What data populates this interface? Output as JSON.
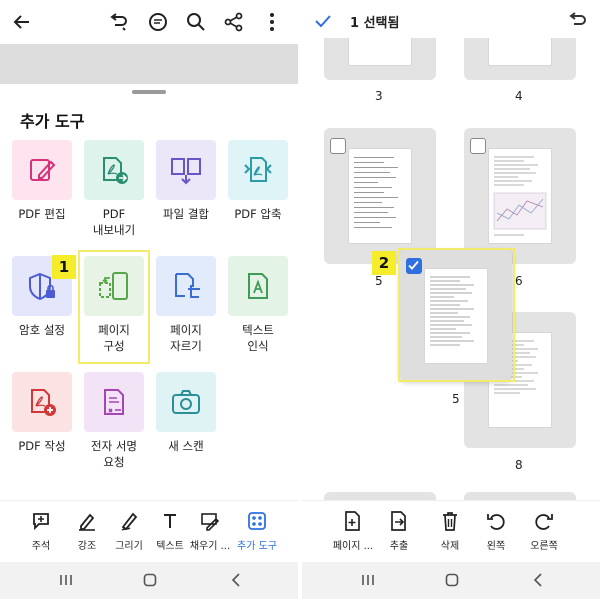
{
  "left": {
    "top_icons": [
      "back-arrow-icon",
      "undo-icon",
      "comment-icon",
      "search-icon",
      "share-icon",
      "more-vertical-icon"
    ],
    "sheet_title": "추가 도구",
    "tools": [
      {
        "label": "PDF 편집",
        "icon": "pdf-edit-icon",
        "bg": "#fde4ef",
        "color": "#d6337a"
      },
      {
        "label": "PDF\n내보내기",
        "icon": "pdf-export-icon",
        "bg": "#ddf3ec",
        "color": "#2a8f72"
      },
      {
        "label": "파일 결합",
        "icon": "file-combine-icon",
        "bg": "#ebe6f8",
        "color": "#6a55c8"
      },
      {
        "label": "PDF 압축",
        "icon": "pdf-compress-icon",
        "bg": "#dff4f6",
        "color": "#2d9aa8"
      },
      {
        "label": "암호 설정",
        "icon": "password-shield-icon",
        "bg": "#e4e6fb",
        "color": "#4c5bd4"
      },
      {
        "label": "페이지\n구성",
        "icon": "organize-pages-icon",
        "bg": "#e7f3e4",
        "color": "#57a64a"
      },
      {
        "label": "페이지\n자르기",
        "icon": "crop-page-icon",
        "bg": "#e2ebfb",
        "color": "#3a6fd1"
      },
      {
        "label": "텍스트\n인식",
        "icon": "text-recognition-icon",
        "bg": "#e3f3e5",
        "color": "#3f9b55"
      },
      {
        "label": "PDF 작성",
        "icon": "pdf-create-icon",
        "bg": "#fce3e3",
        "color": "#d23838"
      },
      {
        "label": "전자 서명\n요청",
        "icon": "e-sign-icon",
        "bg": "#f3e3f6",
        "color": "#a646b6"
      },
      {
        "label": "새 스캔",
        "icon": "camera-icon",
        "bg": "#dff3f4",
        "color": "#2b8f97"
      }
    ],
    "badge1": "1",
    "bottom_tools": [
      {
        "label": "주석",
        "icon": "comment-add-icon"
      },
      {
        "label": "강조",
        "icon": "highlight-icon"
      },
      {
        "label": "그리기",
        "icon": "draw-icon"
      },
      {
        "label": "텍스트",
        "icon": "text-icon"
      },
      {
        "label": "채우기 ...",
        "icon": "fill-sign-icon"
      },
      {
        "label": "추가 도구",
        "icon": "more-tools-icon"
      }
    ]
  },
  "right": {
    "selection_title": "1 선택됨",
    "page_numbers": [
      "3",
      "4",
      "5",
      "6",
      "5",
      "8"
    ],
    "badge2": "2",
    "bottom_actions": [
      {
        "label": "페이지 ...",
        "icon": "insert-page-icon"
      },
      {
        "label": "추출",
        "icon": "extract-icon"
      },
      {
        "label": "삭제",
        "icon": "delete-icon"
      },
      {
        "label": "왼쪽",
        "icon": "rotate-left-icon"
      },
      {
        "label": "오른쪽",
        "icon": "rotate-right-icon"
      }
    ]
  },
  "colors": {
    "accent": "#2f6fe0",
    "highlight": "#f5ec2a"
  }
}
